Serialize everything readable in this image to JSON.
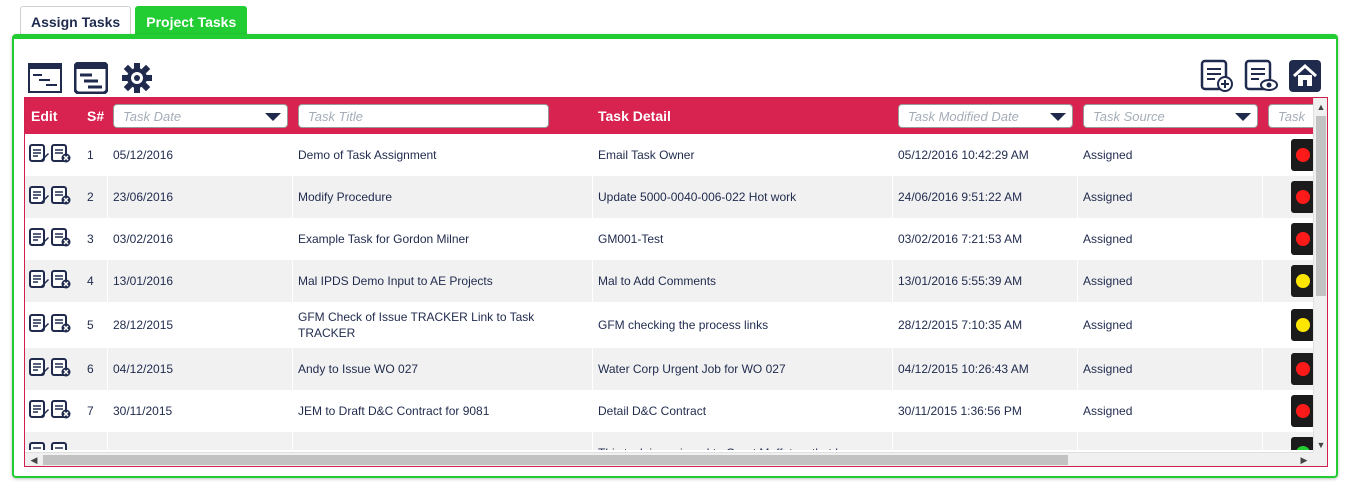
{
  "tabs": [
    {
      "label": "Assign Tasks",
      "active": false
    },
    {
      "label": "Project Tasks",
      "active": true
    }
  ],
  "toolbar": {
    "left_icons": [
      "gantt-chart-icon",
      "gantt-view-icon",
      "settings-gear-icon"
    ],
    "right_icons": [
      "add-task-list-icon",
      "view-task-list-icon",
      "home-icon"
    ]
  },
  "grid": {
    "headers": {
      "edit": "Edit",
      "sno": "S#",
      "task_date_placeholder": "Task Date",
      "task_title_placeholder": "Task Title",
      "task_detail": "Task Detail",
      "modified_placeholder": "Task Modified Date",
      "source_placeholder": "Task Source",
      "status_placeholder": "Task"
    },
    "rows": [
      {
        "sno": "1",
        "date": "05/12/2016",
        "title": "Demo of Task Assignment",
        "detail": "Email Task Owner",
        "modified": "05/12/2016 10:42:29 AM",
        "source": "Assigned",
        "status": "red"
      },
      {
        "sno": "2",
        "date": "23/06/2016",
        "title": "Modify Procedure",
        "detail": "Update 5000-0040-006-022 Hot work",
        "modified": "24/06/2016 9:51:22 AM",
        "source": "Assigned",
        "status": "red"
      },
      {
        "sno": "3",
        "date": "03/02/2016",
        "title": "Example Task for Gordon Milner",
        "detail": "GM001-Test",
        "modified": "03/02/2016 7:21:53 AM",
        "source": "Assigned",
        "status": "red"
      },
      {
        "sno": "4",
        "date": "13/01/2016",
        "title": "Mal IPDS Demo Input to AE Projects",
        "detail": "Mal to Add Comments",
        "modified": "13/01/2016 5:55:39 AM",
        "source": "Assigned",
        "status": "yellow"
      },
      {
        "sno": "5",
        "date": "28/12/2015",
        "title": "GFM Check of Issue TRACKER Link to Task TRACKER",
        "detail": "GFM checking the process links",
        "modified": "28/12/2015 7:10:35 AM",
        "source": "Assigned",
        "status": "yellow"
      },
      {
        "sno": "6",
        "date": "04/12/2015",
        "title": "Andy to Issue WO 027",
        "detail": "Water Corp Urgent Job for WO 027",
        "modified": "04/12/2015 10:26:43 AM",
        "source": "Assigned",
        "status": "red"
      },
      {
        "sno": "7",
        "date": "30/11/2015",
        "title": "JEM to Draft D&C Contract for 9081",
        "detail": "Detail D&C Contract",
        "modified": "30/11/2015 1:36:56 PM",
        "source": "Assigned",
        "status": "red"
      },
      {
        "sno": "",
        "date": "",
        "title": "",
        "detail": "This task is assigned to Grant Moffat so that he can",
        "modified": "",
        "source": "",
        "status": "green"
      }
    ]
  },
  "colors": {
    "accent_green": "#22cc33",
    "header_red": "#d8224f",
    "text_navy": "#1f2a4d",
    "light_red": "#ff1a1a",
    "light_yellow": "#ffe600",
    "light_green": "#22cc33"
  }
}
